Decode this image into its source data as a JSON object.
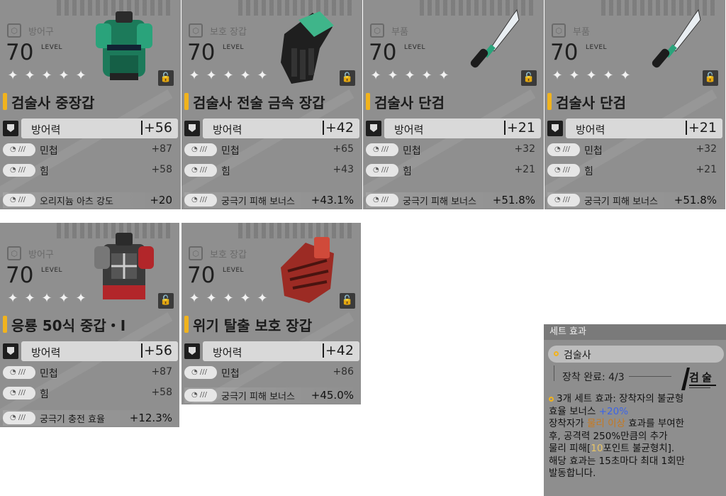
{
  "cards": [
    {
      "category": "방어구",
      "level": "70",
      "level_label": "LEVEL",
      "name": "검술사 중장갑",
      "main_stat": {
        "label": "방어력",
        "value": "+56"
      },
      "stats": [
        {
          "label": "민첩",
          "value": "+87"
        },
        {
          "label": "힘",
          "value": "+58"
        }
      ],
      "bonus": {
        "label": "오리지늄 아츠 강도",
        "value": "+20"
      },
      "image": "green-armor"
    },
    {
      "category": "보호 장갑",
      "level": "70",
      "level_label": "LEVEL",
      "name": "검술사 전술 금속 장갑",
      "main_stat": {
        "label": "방어력",
        "value": "+42"
      },
      "stats": [
        {
          "label": "민첩",
          "value": "+65"
        },
        {
          "label": "힘",
          "value": "+43"
        }
      ],
      "bonus": {
        "label": "궁극기 피해 보너스",
        "value": "+43.1%"
      },
      "image": "green-gloves"
    },
    {
      "category": "부품",
      "level": "70",
      "level_label": "LEVEL",
      "name": "검술사 단검",
      "main_stat": {
        "label": "방어력",
        "value": "+21"
      },
      "stats": [
        {
          "label": "민첩",
          "value": "+32"
        },
        {
          "label": "힘",
          "value": "+21"
        }
      ],
      "bonus": {
        "label": "궁극기 피해 보너스",
        "value": "+51.8%"
      },
      "image": "dagger"
    },
    {
      "category": "부품",
      "level": "70",
      "level_label": "LEVEL",
      "name": "검술사 단검",
      "main_stat": {
        "label": "방어력",
        "value": "+21"
      },
      "stats": [
        {
          "label": "민첩",
          "value": "+32"
        },
        {
          "label": "힘",
          "value": "+21"
        }
      ],
      "bonus": {
        "label": "궁극기 피해 보너스",
        "value": "+51.8%"
      },
      "image": "dagger"
    },
    {
      "category": "방어구",
      "level": "70",
      "level_label": "LEVEL",
      "name": "응룡 50식 중갑・I",
      "main_stat": {
        "label": "방어력",
        "value": "+56"
      },
      "stats": [
        {
          "label": "민첩",
          "value": "+87"
        },
        {
          "label": "힘",
          "value": "+58"
        }
      ],
      "bonus": {
        "label": "궁극기 충전 효율",
        "value": "+12.3%"
      },
      "image": "red-armor"
    },
    {
      "category": "보호 장갑",
      "level": "70",
      "level_label": "LEVEL",
      "name": "위기 탈출 보호 장갑",
      "main_stat": {
        "label": "방어력",
        "value": "+42"
      },
      "stats": [
        {
          "label": "민첩",
          "value": "+86"
        }
      ],
      "bonus": {
        "label": "궁극기 피해 보너스",
        "value": "+45.0%"
      },
      "image": "red-gloves"
    }
  ],
  "set_panel": {
    "title": "세트 효과",
    "set_name": "검술사",
    "equip_status": "장착 완료: 4/3",
    "logo_text": "검술사",
    "desc_part1": "3개 세트 효과: 장착자의 불균형",
    "desc_part2": "효율 보너스",
    "desc_bonus": "+20%",
    "desc_part3": "장착자가",
    "desc_keyword": "물리 이상",
    "desc_part4": "효과를 부여한",
    "desc_part5": "후, 공격력 250%만큼의 추가",
    "desc_part6": "물리 피해[",
    "desc_num": "10",
    "desc_part7": "포인트 불균형치].",
    "desc_part8": "해당 효과는 15초마다 최대 1회만",
    "desc_part9": "발동합니다."
  },
  "colors": {
    "accent": "#f1b31d",
    "bonus_blue": "#3b64e8",
    "keyword_orange": "#c7791f",
    "panel_bg": "#8f8f8f"
  }
}
